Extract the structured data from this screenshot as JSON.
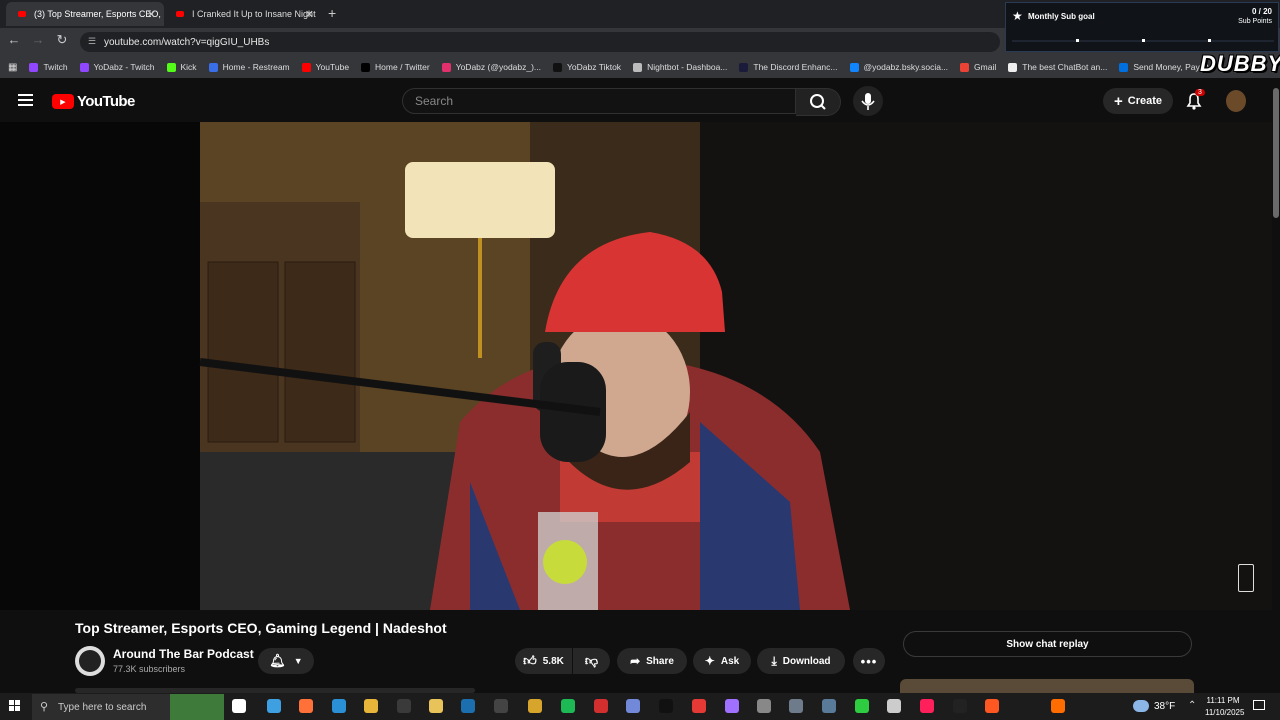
{
  "browser": {
    "tabs": [
      {
        "title": "(3) Top Streamer, Esports CEO,",
        "close": "✕"
      },
      {
        "title": "I Cranked It Up to Insane Night",
        "close": "✕"
      }
    ],
    "new_tab": "+",
    "url": "youtube.com/watch?v=qigGIU_UHBs",
    "bookmarks": [
      {
        "label": "Twitch",
        "color": "#9146ff"
      },
      {
        "label": "YoDabz - Twitch",
        "color": "#9146ff"
      },
      {
        "label": "Kick",
        "color": "#53fc18"
      },
      {
        "label": "Home - Restream",
        "color": "#3a6ee8"
      },
      {
        "label": "YouTube",
        "color": "#ff0000"
      },
      {
        "label": "Home / Twitter",
        "color": "#000000"
      },
      {
        "label": "YoDabz (@yodabz_)...",
        "color": "#e1306c"
      },
      {
        "label": "YoDabz Tiktok",
        "color": "#111111"
      },
      {
        "label": "Nightbot - Dashboa...",
        "color": "#bbbbbb"
      },
      {
        "label": "The Discord Enhanc...",
        "color": "#1a1a3a"
      },
      {
        "label": "@yodabz.bsky.socia...",
        "color": "#1185fe"
      },
      {
        "label": "Gmail",
        "color": "#ea4335"
      },
      {
        "label": "The best ChatBot an...",
        "color": "#eeeeee"
      },
      {
        "label": "Send Money, Pay O...",
        "color": "#0070e0"
      }
    ],
    "bookmarks_more": "»"
  },
  "overlay": {
    "goal_title": "Monthly Sub goal",
    "goal_value": "0 / 20",
    "goal_unit": "Sub Points",
    "goal_progress": 0,
    "brand": "DUBBY"
  },
  "youtube": {
    "logo_text": "YouTube",
    "search_placeholder": "Search",
    "create_label": "Create",
    "notification_count": "3",
    "video_title": "Top Streamer, Esports CEO, Gaming Legend | Nadeshot",
    "channel_name": "Around The Bar Podcast",
    "subscribers": "77.3K subscribers",
    "likes": "5.8K",
    "share_label": "Share",
    "ask_label": "Ask",
    "download_label": "Download",
    "chat_replay_label": "Show chat replay",
    "accent": "#ff0000"
  },
  "taskbar": {
    "search_placeholder": "Type here to search",
    "temperature": "38°F",
    "time": "11:11 PM",
    "date": "11/10/2025"
  }
}
